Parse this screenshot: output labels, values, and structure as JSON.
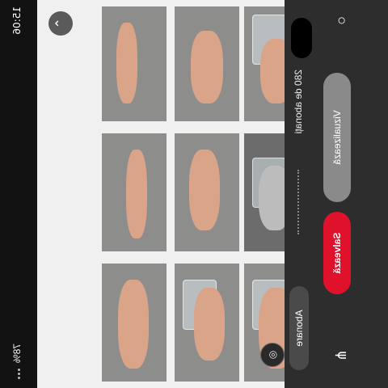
{
  "status_bar": {
    "time": "15:06",
    "battery": "78%"
  },
  "grid": {
    "back_icon": "chevron-up-icon",
    "lens_icon": "lens-search-icon",
    "tiles": [
      {
        "name": "hand-fingers-tile"
      },
      {
        "name": "hand-open-tile"
      },
      {
        "name": "hand-glass-tile"
      },
      {
        "name": "hand-relaxed-tile"
      },
      {
        "name": "hand-raised-tile"
      },
      {
        "name": "hand-glass-bw-tile"
      },
      {
        "name": "hand-point-tile"
      },
      {
        "name": "hand-glass-hold-tile"
      },
      {
        "name": "hand-glass-grip-tile"
      }
    ]
  },
  "profile": {
    "subscribers": "280 de abonați",
    "view_label": "Vizualizează",
    "save_label": "Salvează",
    "subscribe_label": "Abonare",
    "pin_icon": "pinterest-icon",
    "share_icon": "share-icon"
  }
}
